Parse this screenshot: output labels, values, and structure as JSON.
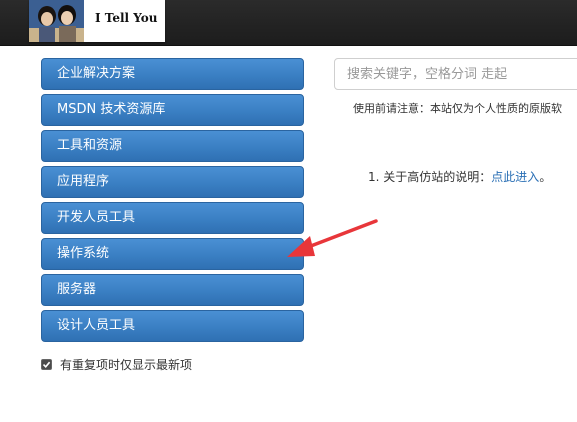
{
  "header": {
    "site_title": "I Tell You"
  },
  "sidebar": {
    "items": [
      {
        "label": "企业解决方案"
      },
      {
        "label": "MSDN 技术资源库"
      },
      {
        "label": "工具和资源"
      },
      {
        "label": "应用程序"
      },
      {
        "label": "开发人员工具"
      },
      {
        "label": "操作系统"
      },
      {
        "label": "服务器"
      },
      {
        "label": "设计人员工具"
      }
    ],
    "show_latest_checkbox": {
      "label": "有重复项时仅显示最新项",
      "checked": true
    }
  },
  "main": {
    "search": {
      "placeholder": "搜索关键字，空格分词 走起",
      "value": ""
    },
    "notice": "使用前请注意：本站仅为个人性质的原版软",
    "list": [
      {
        "index": "1.",
        "text": "关于高仿站的说明：",
        "link": "点此进入",
        "suffix": "。"
      }
    ]
  },
  "colors": {
    "menu_button": "#3a7fc3",
    "topbar": "#222222",
    "link": "#2a6fb5",
    "annotation_arrow": "#e8363a"
  },
  "icons": {
    "logo": "avatar-photo",
    "checkbox": "check-icon"
  }
}
